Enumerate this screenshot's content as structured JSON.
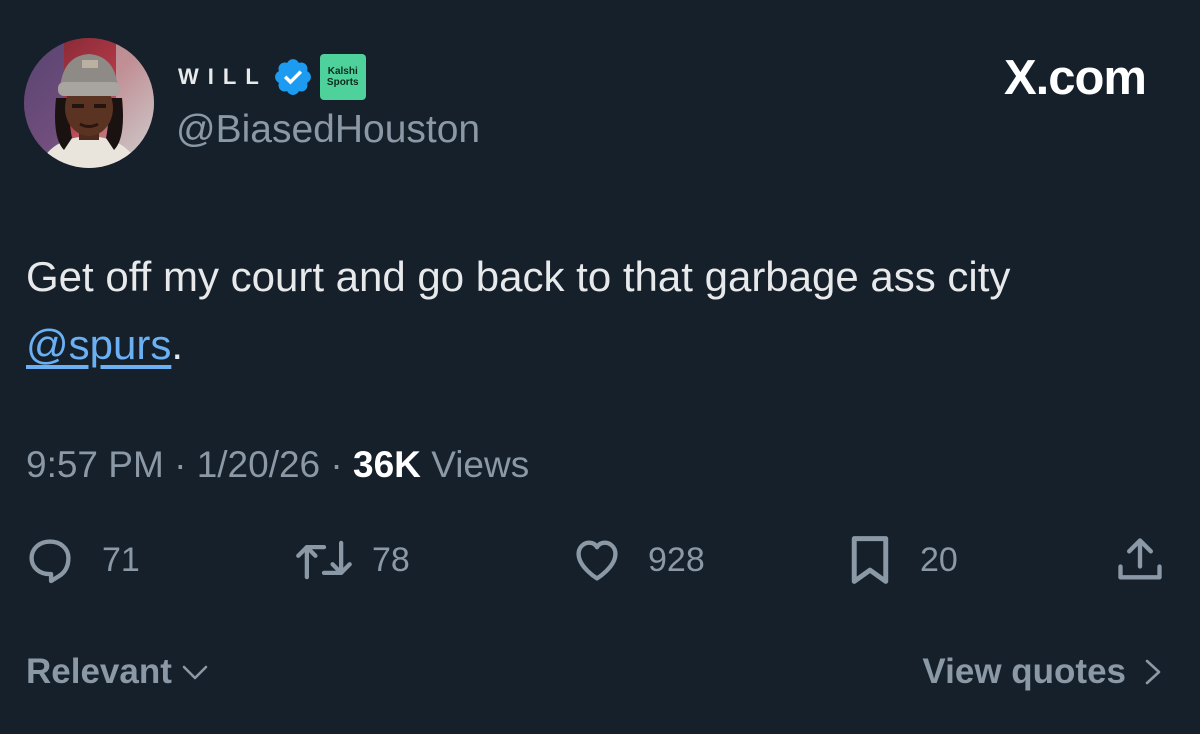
{
  "author": {
    "display_name": "WILL",
    "handle": "@BiasedHouston",
    "verified": true,
    "affiliate_badge": {
      "line1": "Kalshi",
      "line2": "Sports",
      "color": "#4ed19a"
    }
  },
  "site_logo": "X.com",
  "tweet": {
    "text_before": "Get off my court and go back to that garbage ass city ",
    "mention": "@spurs",
    "text_after": "."
  },
  "meta": {
    "time": "9:57 PM",
    "separator": "·",
    "date": "1/20/26",
    "views_count": "36K",
    "views_label": "Views"
  },
  "actions": {
    "replies": "71",
    "reposts": "78",
    "likes": "928",
    "bookmarks": "20"
  },
  "footer": {
    "sort_label": "Relevant",
    "view_quotes_label": "View quotes"
  },
  "colors": {
    "background": "#15202b",
    "text": "#e7e9ea",
    "secondary": "#8b98a5",
    "link": "#6ab0f3",
    "verified": "#1d9bf0"
  },
  "icons": {
    "reply": "speech-bubble-icon",
    "repost": "repost-arrows-icon",
    "like": "heart-icon",
    "bookmark": "bookmark-icon",
    "share": "share-upload-icon"
  }
}
